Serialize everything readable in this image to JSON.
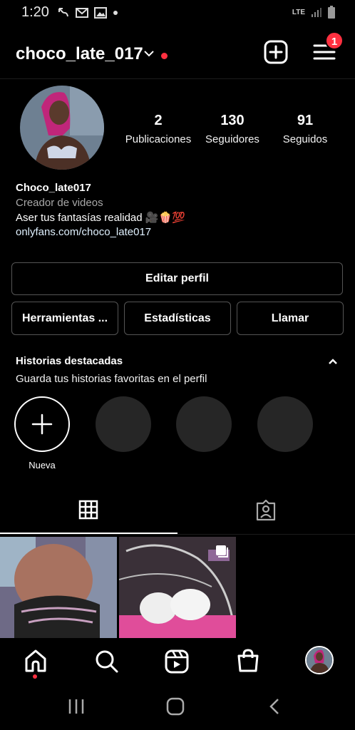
{
  "status": {
    "time": "1:20",
    "network": "LTE"
  },
  "header": {
    "username": "choco_late_017",
    "notification_count": "1"
  },
  "profile": {
    "stats": [
      {
        "value": "2",
        "label": "Publicaciones"
      },
      {
        "value": "130",
        "label": "Seguidores"
      },
      {
        "value": "91",
        "label": "Seguidos"
      }
    ],
    "name": "Choco_late017",
    "category": "Creador de videos",
    "bio": "Aser tus fantasías realidad 🎥🍿💯",
    "link": "onlyfans.com/choco_late017"
  },
  "buttons": {
    "edit_profile": "Editar perfil",
    "tools": "Herramientas ...",
    "stats": "Estadísticas",
    "call": "Llamar"
  },
  "highlights": {
    "title": "Historias destacadas",
    "subtitle": "Guarda tus historias favoritas en el perfil",
    "new_label": "Nueva"
  },
  "colors": {
    "accent_red": "#ff3040",
    "background": "#000000",
    "placeholder": "#262626"
  }
}
